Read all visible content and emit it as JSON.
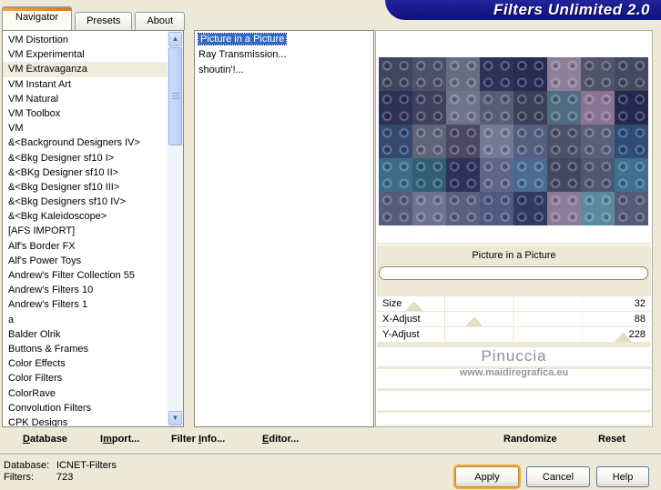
{
  "window": {
    "banner_title": "Filters Unlimited 2.0"
  },
  "tabs": [
    {
      "label": "Navigator",
      "active": true
    },
    {
      "label": "Presets",
      "active": false
    },
    {
      "label": "About",
      "active": false
    }
  ],
  "category_list": {
    "selected_index": 2,
    "items": [
      "VM Distortion",
      "VM Experimental",
      "VM Extravaganza",
      "VM Instant Art",
      "VM Natural",
      "VM Toolbox",
      "VM",
      "&<Background Designers IV>",
      "&<Bkg Designer sf10 I>",
      "&<BKg Designer sf10 II>",
      "&<Bkg Designer sf10 III>",
      "&<Bkg Designers sf10 IV>",
      "&<Bkg Kaleidoscope>",
      "[AFS IMPORT]",
      "Alf's Border FX",
      "Alf's Power Toys",
      "Andrew's Filter Collection 55",
      "Andrew's Filters 10",
      "Andrew's Filters 1",
      "a",
      "Balder Olrik",
      "Buttons & Frames",
      "Color Effects",
      "Color Filters",
      "ColorRave",
      "Convolution Filters",
      "CPK Designs"
    ]
  },
  "filter_list": {
    "selected_index": 0,
    "items": [
      "Picture in a Picture",
      "Ray Transmission...",
      "shoutin'!..."
    ]
  },
  "preview": {
    "cols": 8,
    "tile_colors": [
      "#41465f",
      "#4c5069",
      "#686c80",
      "#2f3258",
      "#282c52",
      "#8d7f97",
      "#515468",
      "#45495f",
      "#2d3156",
      "#413e5e",
      "#707389",
      "#585c76",
      "#3c4059",
      "#506c82",
      "#8b7394",
      "#252950",
      "#35486e",
      "#606478",
      "#4c4864",
      "#727b95",
      "#556080",
      "#4d5168",
      "#58617b",
      "#2e4c76",
      "#3e6b8a",
      "#305f75",
      "#2e3158",
      "#5d6686",
      "#486b92",
      "#434762",
      "#4f5871",
      "#3e7090",
      "#565c7c",
      "#6b7292",
      "#586180",
      "#505a7e",
      "#303a60",
      "#8d7a99",
      "#5c88a0",
      "#535a7a"
    ]
  },
  "filter_panel": {
    "title": "Picture in a Picture",
    "sliders": [
      {
        "label": "Size",
        "value": 32,
        "max": 255
      },
      {
        "label": "X-Adjust",
        "value": 88,
        "max": 255
      },
      {
        "label": "Y-Adjust",
        "value": 228,
        "max": 255
      }
    ],
    "watermark": {
      "line1": "Pinuccia",
      "line2": "www.maidiregrafica.eu"
    }
  },
  "action_bar": {
    "buttons": [
      {
        "label": "Database",
        "underline": 0
      },
      {
        "label": "Import...",
        "underline": 1
      },
      {
        "label": "Filter Info...",
        "underline": 7
      },
      {
        "label": "Editor...",
        "underline": 0
      },
      {
        "label": "Randomize",
        "underline": null
      },
      {
        "label": "Reset",
        "underline": null
      }
    ]
  },
  "status": {
    "rows": [
      {
        "label": "Database:",
        "value": "ICNET-Filters"
      },
      {
        "label": "Filters:",
        "value": "723"
      }
    ]
  },
  "dialog_buttons": [
    {
      "label": "Apply",
      "focused": true
    },
    {
      "label": "Cancel",
      "focused": false
    },
    {
      "label": "Help",
      "focused": false
    }
  ],
  "colors": {
    "banner_bg": "#15158c",
    "selection_blue": "#316ac5",
    "chrome_beige": "#ece9d8",
    "tab_accent_orange": "#e8821e",
    "apply_focus_ring": "#f3a638"
  }
}
